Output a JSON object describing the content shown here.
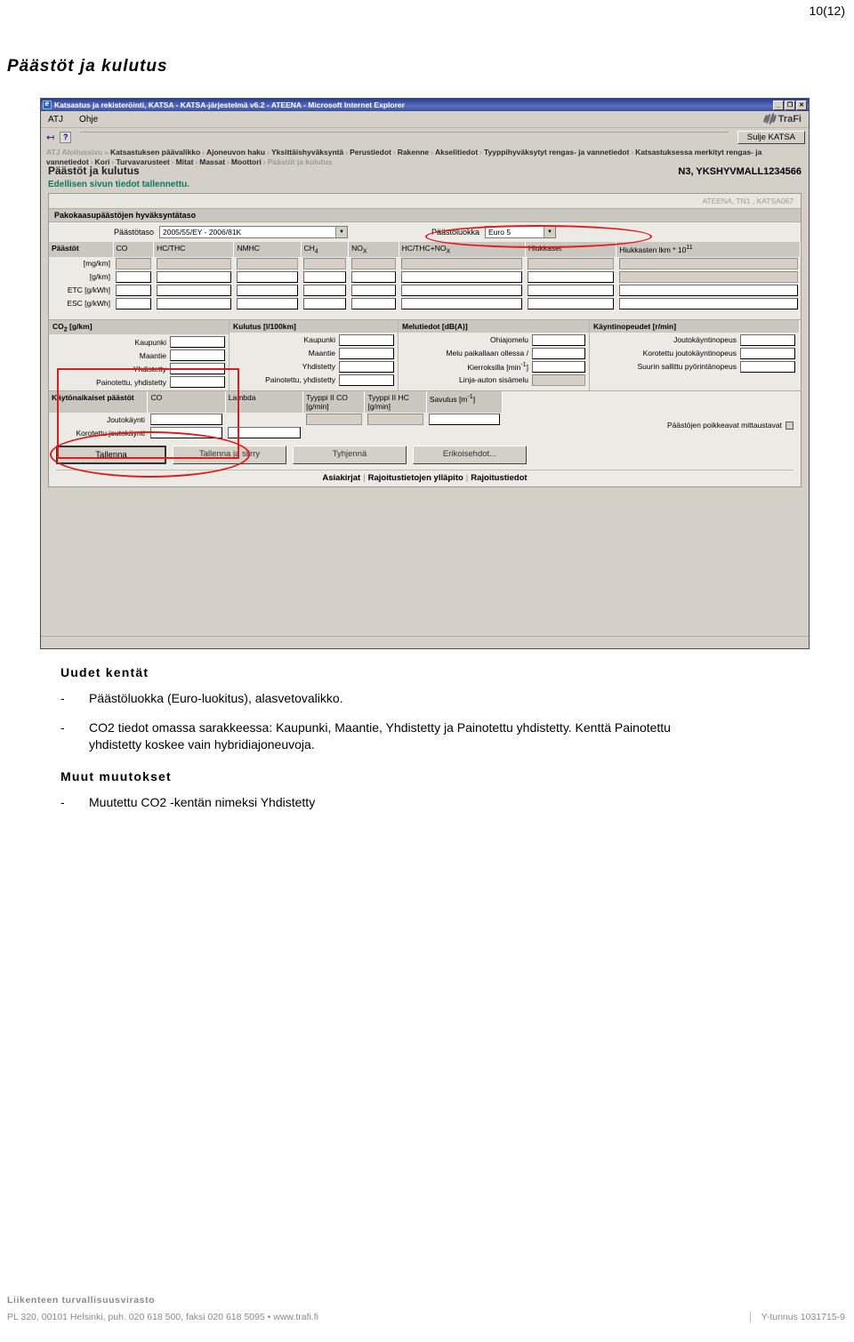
{
  "document": {
    "page_number": "10(12)",
    "title": "Päästöt ja kulutus"
  },
  "screenshot": {
    "window_title": "Katsastus ja rekisteröinti, KATSA - KATSA-järjestelmä v6.2 - ATEENA - Microsoft Internet Explorer",
    "window_buttons": {
      "minimize": "_",
      "maximize": "❐",
      "close": "✕"
    },
    "menu": {
      "items": [
        "ATJ",
        "Ohje"
      ]
    },
    "brand": {
      "name": "TraFi",
      "logo_icon": "trafi-swoosh-icon"
    },
    "toolbar": {
      "back_icon": "back-arrow-icon",
      "help_icon": "help-question-icon",
      "close_katsa_label": "Sulje KATSA"
    },
    "breadcrumb": {
      "items": [
        "ATJ Aloitussivu",
        "Katsastuksen päävalikko",
        "Ajoneuvon haku",
        "Yksittäishyväksyntä",
        "Perustiedot",
        "Rakenne",
        "Akselitiedot",
        "Tyyppihyväksytyt rengas- ja vannetiedot",
        "Katsastuksessa merkityt rengas- ja vannetiedot",
        "Kori",
        "Turvavarusteet",
        "Mitat",
        "Massat",
        "Moottori",
        "Päästöt ja kulutus"
      ],
      "separator": "›",
      "first_separator": "»"
    },
    "page": {
      "heading": "Päästöt ja kulutus",
      "vehicle_id": "N3, YKSHYVMALL1234566",
      "status_message": "Edellisen sivun tiedot tallennettu.",
      "session_info": "ATEENA, TN1 , KATSA067"
    },
    "approval_section": {
      "header": "Pakokaasupäästöjen hyväksyntätaso",
      "emission_level": {
        "label": "Päästötaso",
        "value": "2005/55/EY - 2006/81K"
      },
      "emission_class": {
        "label": "Päästöluokka",
        "value": "Euro 5"
      }
    },
    "emissions_table": {
      "corner_label": "Päästöt",
      "columns": [
        "CO",
        "HC/THC",
        "NMHC",
        "CH4",
        "NOx",
        "HC/THC+NOx",
        "Hiukkaset",
        "Hiukkasten lkm * 10^11"
      ],
      "rows": [
        "[mg/km]",
        "[g/km]",
        "ETC [g/kWh]",
        "ESC [g/kWh]"
      ]
    },
    "co2_section": {
      "header": "CO2 [g/km]",
      "fields": [
        "Kaupunki",
        "Maantie",
        "Yhdistetty",
        "Painotettu, yhdistetty"
      ]
    },
    "consumption_section": {
      "header": "Kulutus [l/100km]",
      "fields": [
        "Kaupunki",
        "Maantie",
        "Yhdistetty",
        "Painotettu, yhdistetty"
      ]
    },
    "noise_section": {
      "header": "Melutiedot [dB(A)]",
      "fields": [
        "Ohiajomelu",
        "Melu paikallaan ollessa /",
        "Kierroksilla [min-1]",
        "Linja-auton sisämelu"
      ]
    },
    "speeds_section": {
      "header": "Käyntinopeudet [r/min]",
      "fields": [
        "Joutokäyntinopeus",
        "Korotettu joutokäyntinopeus",
        "Suurin sallittu pyörintänopeus"
      ]
    },
    "inuse_section": {
      "corner_label": "Käytönaikaiset päästöt",
      "columns": [
        "CO",
        "Lambda",
        "Tyyppi II CO [g/min]",
        "Tyyppi II HC [g/min]",
        "Savutus [m-1]"
      ],
      "rows": [
        "Joutokäynti",
        "Korotettu joutokäynti"
      ],
      "checkbox_label": "Päästöjen poikkeavat mittaustavat"
    },
    "buttons": [
      "Tallenna",
      "Tallenna ja siirry",
      "Tyhjennä",
      "Erikoisehdot..."
    ],
    "footer_links": [
      "Asiakirjat",
      "Rajoitustietojen ylläpito",
      "Rajoitustiedot"
    ],
    "link_separator": "|",
    "annotation_color": "#e01b1b"
  },
  "content": {
    "section_new": {
      "heading": "Uudet kentät",
      "bullets": [
        {
          "marker": "-",
          "text": "Päästöluokka (Euro-luokitus), alasvetovalikko."
        },
        {
          "marker": "-",
          "text": "CO2 tiedot omassa sarakkeessa: Kaupunki, Maantie, Yhdistetty ja Painotettu yhdistetty. Kenttä Painotettu yhdistetty koskee vain hybridiajoneuvoja."
        }
      ]
    },
    "section_other": {
      "heading": "Muut muutokset",
      "bullets": [
        {
          "marker": "-",
          "text": "Muutettu CO2 -kentän nimeksi Yhdistetty"
        }
      ]
    }
  },
  "footer": {
    "organization": "Liikenteen turvallisuusvirasto",
    "address": "PL 320, 00101 Helsinki, puh. 020 618 500, faksi 020 618 5095 • www.trafi.fi",
    "business_id": "Y-tunnus 1031715-9"
  }
}
